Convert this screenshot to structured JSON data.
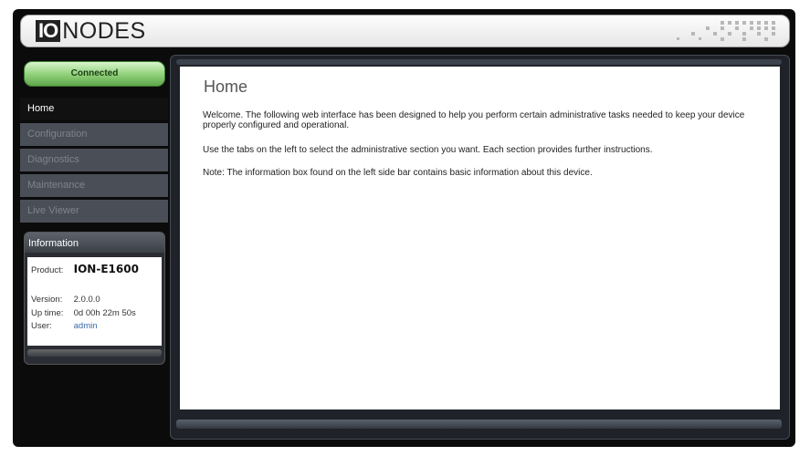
{
  "header": {
    "logo_io": "IO",
    "logo_text": "NODES"
  },
  "status": {
    "label": "Connected",
    "color": "#7cc466"
  },
  "nav": {
    "items": [
      {
        "label": "Home",
        "active": true
      },
      {
        "label": "Configuration",
        "active": false
      },
      {
        "label": "Diagnostics",
        "active": false
      },
      {
        "label": "Maintenance",
        "active": false
      },
      {
        "label": "Live Viewer",
        "active": false
      }
    ]
  },
  "info": {
    "title": "Information",
    "product_label": "Product:",
    "product_value": "ION-E1600",
    "version_label": "Version:",
    "version_value": "2.0.0.0",
    "uptime_label": "Up time:",
    "uptime_value": "0d 00h 22m 50s",
    "user_label": "User:",
    "user_value": "admin"
  },
  "main": {
    "title": "Home",
    "paragraphs": [
      "Welcome.  The following web interface has been designed to help you perform certain administrative tasks needed to keep your device properly configured and operational.",
      "Use the tabs on the left to select the administrative section you want.  Each section provides further instructions.",
      "Note: The information box found on the left side bar contains basic information about this device."
    ]
  }
}
